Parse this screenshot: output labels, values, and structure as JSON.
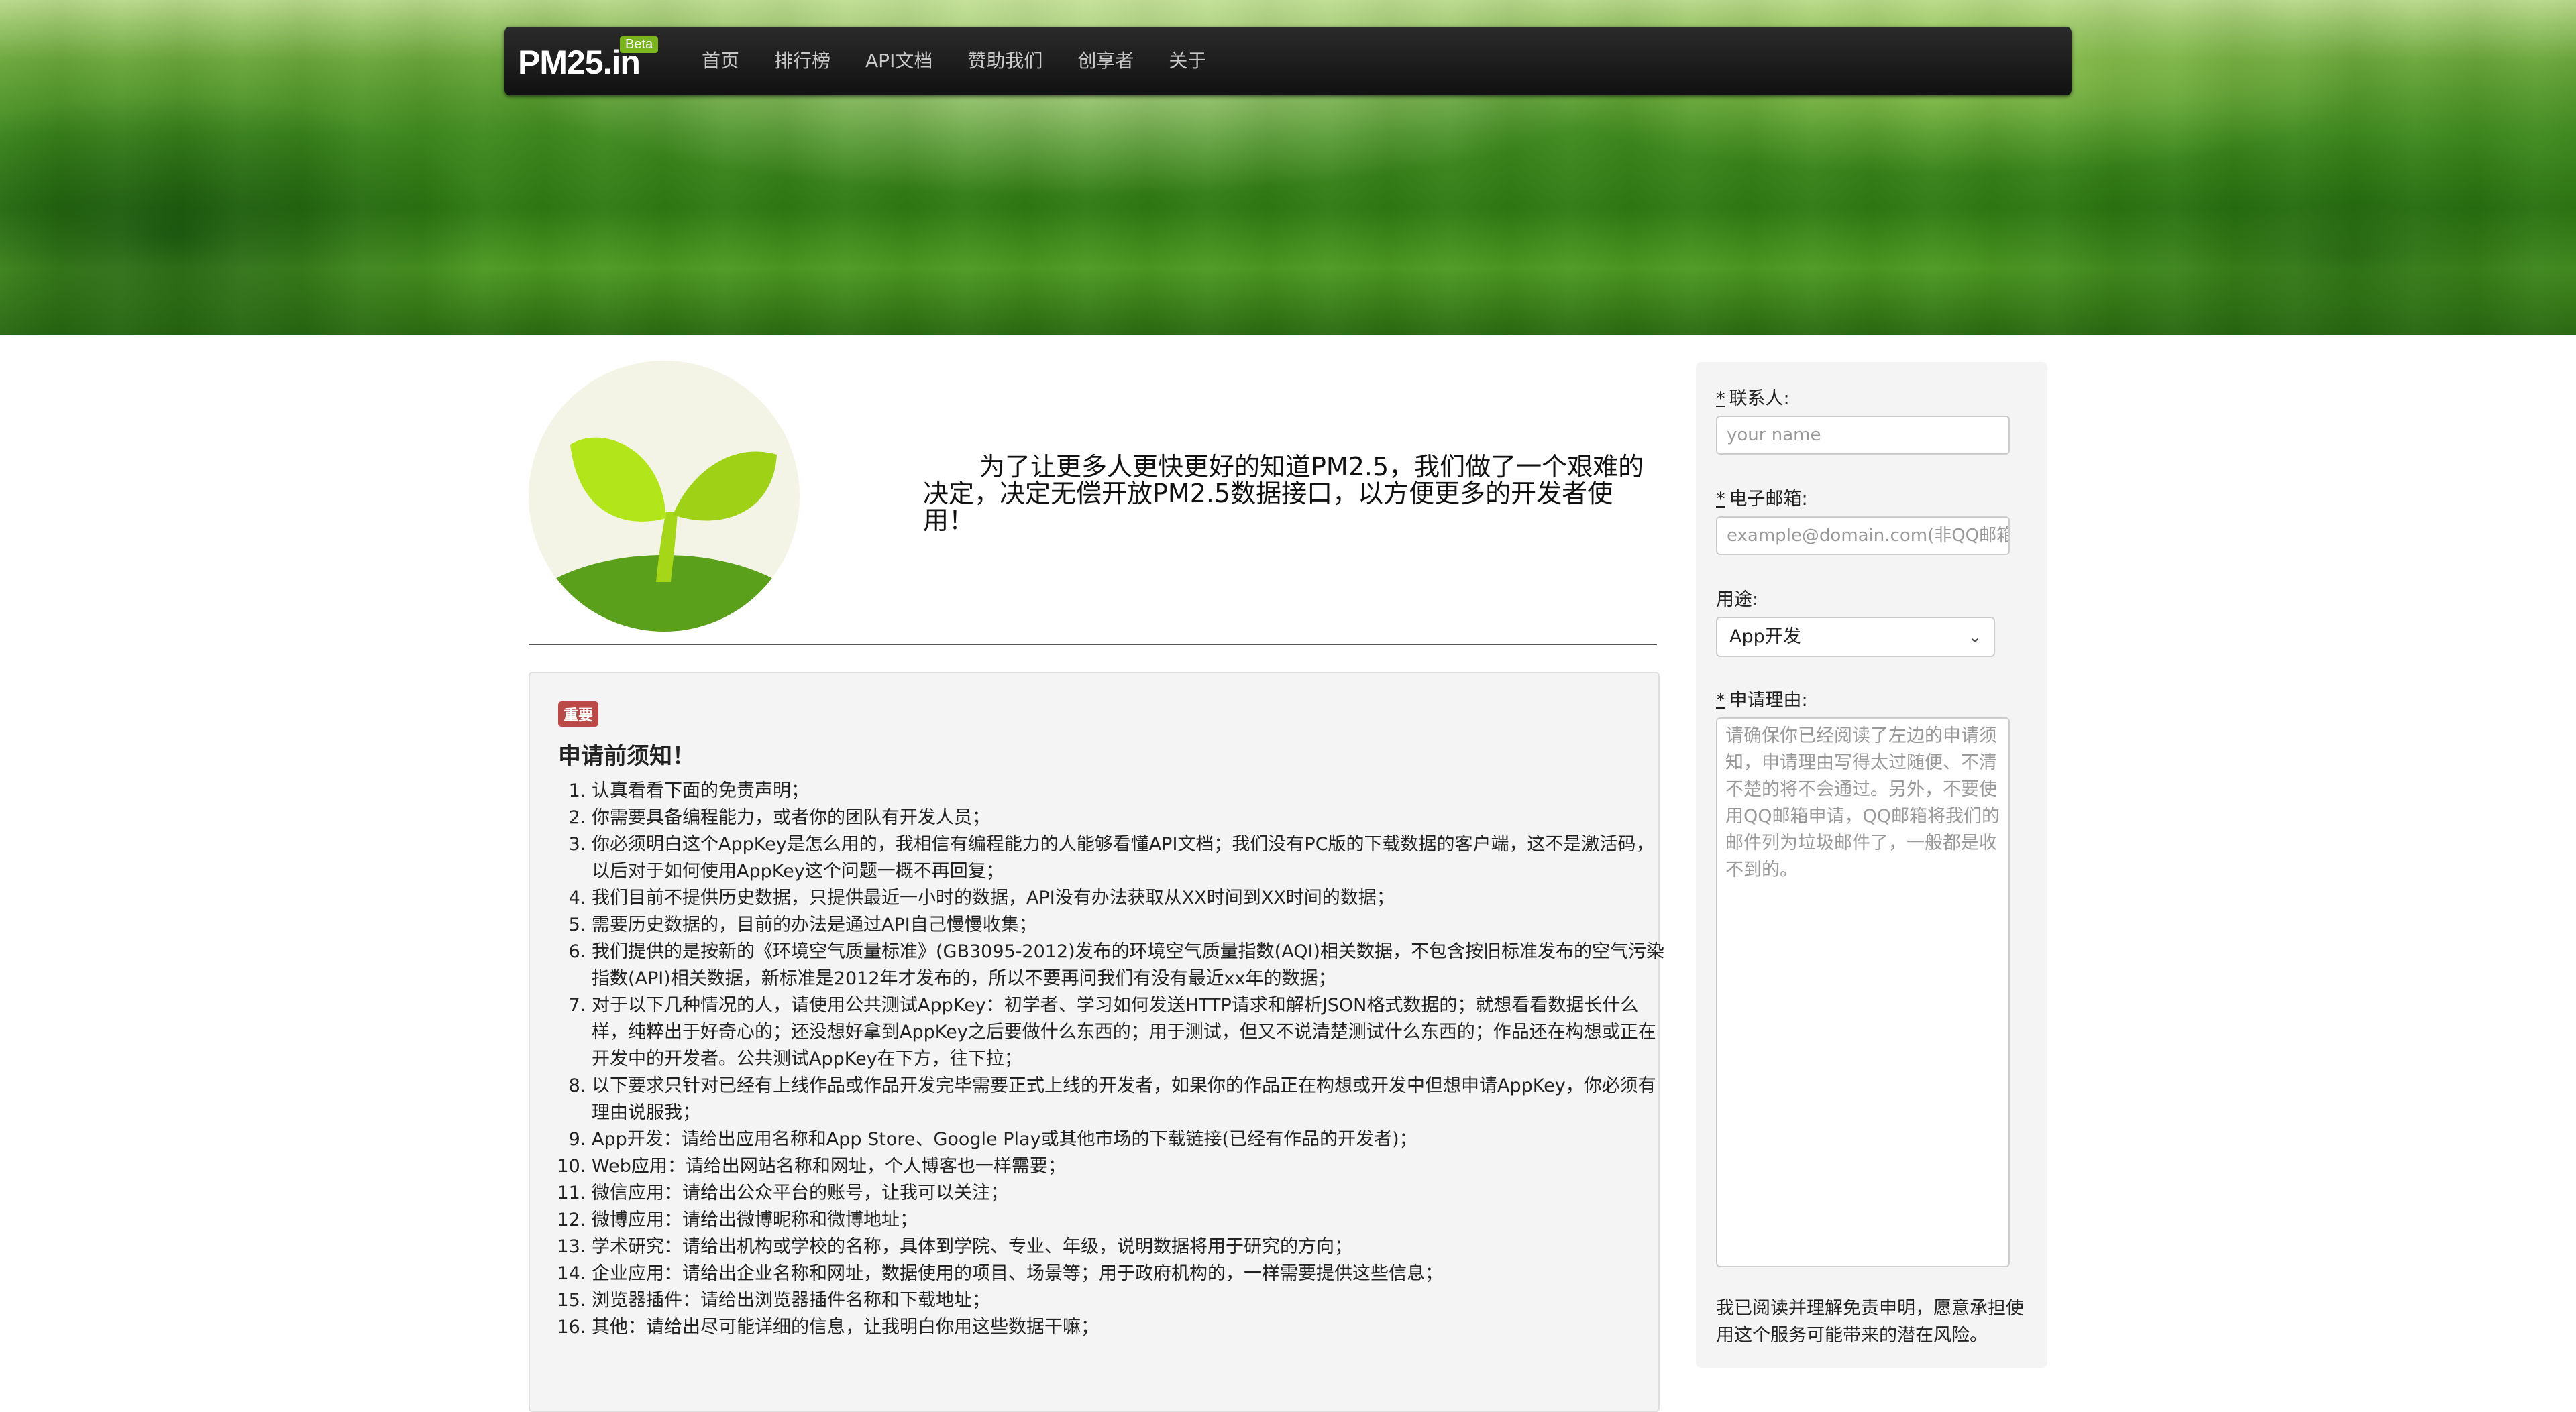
{
  "nav": {
    "brand": "PM25.in",
    "beta": "Beta",
    "items": [
      "首页",
      "排行榜",
      "API文档",
      "赞助我们",
      "创享者",
      "关于"
    ]
  },
  "intro": {
    "text": "为了让更多人更快更好的知道PM2.5，我们做了一个艰难的决定，决定无偿开放PM2.5数据接口，以方便更多的开发者使用！"
  },
  "notice": {
    "badge": "重要",
    "title": "申请前须知！",
    "items": [
      "认真看看下面的免责声明；",
      "你需要具备编程能力，或者你的团队有开发人员；",
      "你必须明白这个AppKey是怎么用的，我相信有编程能力的人能够看懂API文档；我们没有PC版的下载数据的客户端，这不是激活码，以后对于如何使用AppKey这个问题一概不再回复；",
      "我们目前不提供历史数据，只提供最近一小时的数据，API没有办法获取从XX时间到XX时间的数据；",
      "需要历史数据的，目前的办法是通过API自己慢慢收集；",
      "我们提供的是按新的《环境空气质量标准》(GB3095-2012)发布的环境空气质量指数(AQI)相关数据，不包含按旧标准发布的空气污染指数(API)相关数据，新标准是2012年才发布的，所以不要再问我们有没有最近xx年的数据；",
      "对于以下几种情况的人，请使用公共测试AppKey：初学者、学习如何发送HTTP请求和解析JSON格式数据的；就想看看数据长什么样，纯粹出于好奇心的；还没想好拿到AppKey之后要做什么东西的；用于测试，但又不说清楚测试什么东西的；作品还在构想或正在开发中的开发者。公共测试AppKey在下方，往下拉；",
      "以下要求只针对已经有上线作品或作品开发完毕需要正式上线的开发者，如果你的作品正在构想或开发中但想申请AppKey，你必须有理由说服我；",
      "App开发：请给出应用名称和App Store、Google Play或其他市场的下载链接(已经有作品的开发者)；",
      "Web应用：请给出网站名称和网址，个人博客也一样需要；",
      "微信应用：请给出公众平台的账号，让我可以关注；",
      "微博应用：请给出微博昵称和微博地址；",
      "学术研究：请给出机构或学校的名称，具体到学院、专业、年级，说明数据将用于研究的方向；",
      "企业应用：请给出企业名称和网址，数据使用的项目、场景等；用于政府机构的，一样需要提供这些信息；",
      "浏览器插件：请给出浏览器插件名称和下载地址；",
      "其他：请给出尽可能详细的信息，让我明白你用这些数据干嘛；"
    ]
  },
  "form": {
    "contact_label": "联系人:",
    "contact_placeholder": "your name",
    "email_label": "电子邮箱:",
    "email_placeholder": "example@domain.com(非QQ邮箱)",
    "purpose_label": "用途:",
    "purpose_value": "App开发",
    "reason_label": "申请理由:",
    "reason_placeholder": "请确保你已经阅读了左边的申请须知，申请理由写得太过随便、不清不楚的将不会通过。另外，不要使用QQ邮箱申请，QQ邮箱将我们的邮件列为垃圾邮件了，一般都是收不到的。",
    "required_mark": "*",
    "agreement": "我已阅读并理解免责申明，愿意承担使用这个服务可能带来的潜在风险。"
  }
}
